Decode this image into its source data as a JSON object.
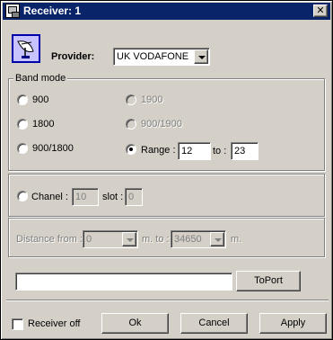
{
  "window": {
    "title": "Receiver: 1",
    "close_glyph": "✕",
    "icons": {
      "app": "window-app-icon",
      "provider": "satellite-dish-icon"
    }
  },
  "provider": {
    "label": "Provider:",
    "value": "UK VODAFONE"
  },
  "band_mode": {
    "label": "Band mode",
    "options": [
      {
        "label": "900",
        "checked": false,
        "enabled": true
      },
      {
        "label": "1800",
        "checked": false,
        "enabled": true
      },
      {
        "label": "900/1800",
        "checked": false,
        "enabled": true
      },
      {
        "label": "1900",
        "checked": false,
        "enabled": false
      },
      {
        "label": "900/1900",
        "checked": false,
        "enabled": false
      },
      {
        "label": "Range :",
        "checked": true,
        "enabled": true
      }
    ],
    "range_from": "12",
    "range_to_label": "to :",
    "range_to": "23"
  },
  "chanel": {
    "label": "Chanel :",
    "value": "10",
    "slot_label": "slot :",
    "slot_value": "0"
  },
  "distance": {
    "from_label": "Distance from :",
    "from_value": "0",
    "mid_label": "m. to :",
    "to_value": "34650",
    "unit": "m."
  },
  "port": {
    "input_value": "",
    "button_label": "ToPort"
  },
  "footer": {
    "receiver_off_label": "Receiver off",
    "receiver_off_checked": false,
    "ok_label": "Ok",
    "cancel_label": "Cancel",
    "apply_label": "Apply"
  }
}
